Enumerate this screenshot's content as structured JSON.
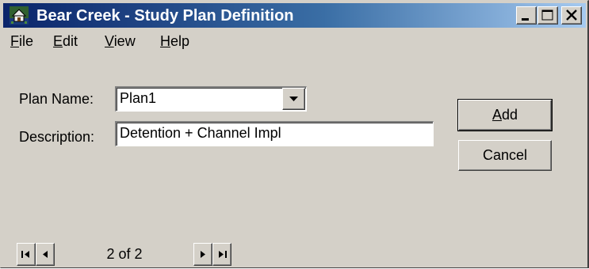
{
  "window": {
    "title": "Bear Creek - Study Plan Definition",
    "title_bar_start_color": "#0a246a",
    "title_bar_end_color": "#a6caf0"
  },
  "title_buttons": [
    {
      "name": "minimize",
      "icon": "minimize-icon"
    },
    {
      "name": "maximize",
      "icon": "maximize-icon"
    },
    {
      "name": "close",
      "icon": "close-icon"
    }
  ],
  "menu": {
    "file": {
      "mnemonic": "F",
      "rest": "ile"
    },
    "edit": {
      "mnemonic": "E",
      "rest": "dit"
    },
    "view": {
      "mnemonic": "V",
      "rest": "iew"
    },
    "help": {
      "mnemonic": "H",
      "rest": "elp"
    }
  },
  "form": {
    "plan_name_label": "Plan Name:",
    "plan_name_value": "Plan1",
    "description_label": "Description:",
    "description_value": "Detention + Channel Impl"
  },
  "buttons": {
    "add": {
      "mnemonic": "A",
      "rest": "dd"
    },
    "cancel": "Cancel"
  },
  "navigator": {
    "record_text": "2 of 2"
  }
}
